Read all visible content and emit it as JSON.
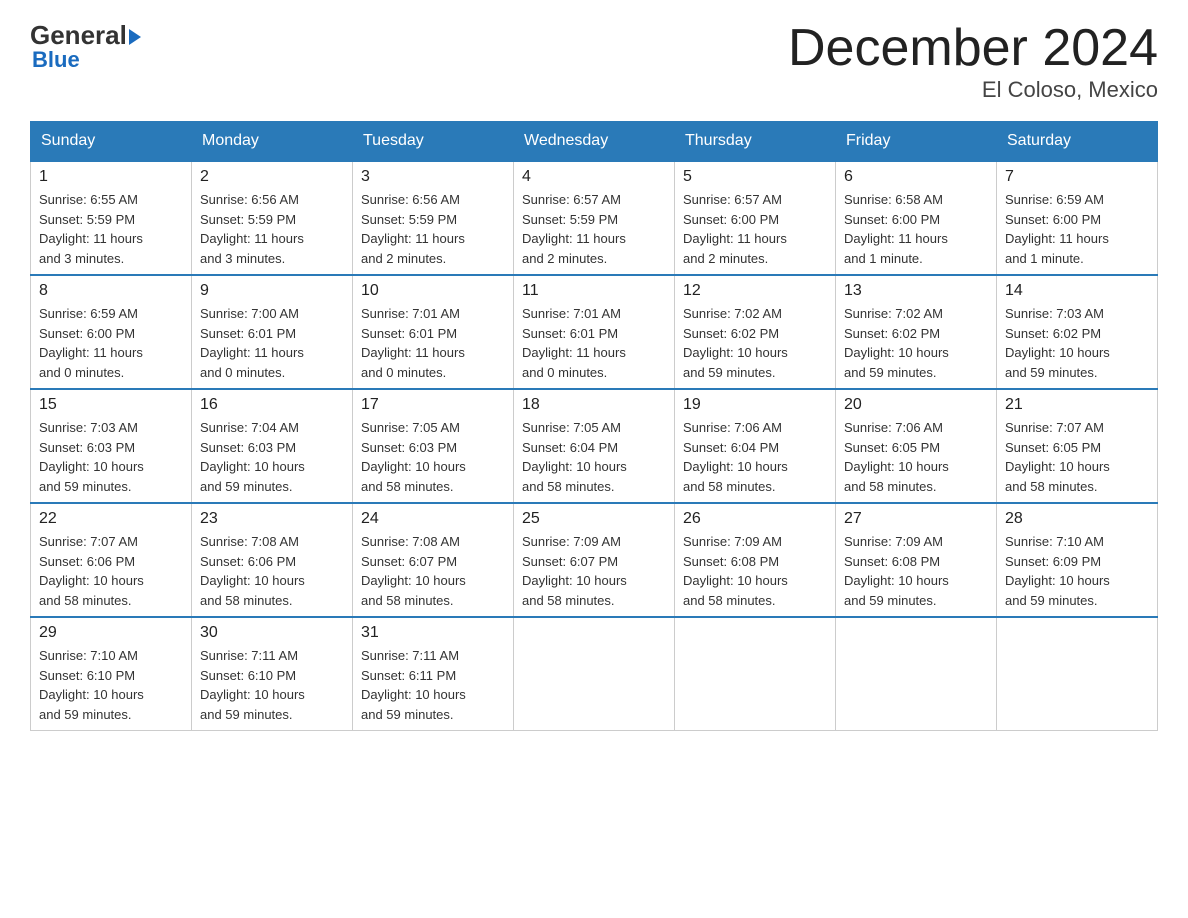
{
  "header": {
    "logo_top": "General",
    "logo_bottom": "Blue",
    "title": "December 2024",
    "subtitle": "El Coloso, Mexico"
  },
  "weekdays": [
    "Sunday",
    "Monday",
    "Tuesday",
    "Wednesday",
    "Thursday",
    "Friday",
    "Saturday"
  ],
  "weeks": [
    [
      {
        "day": "1",
        "sunrise": "6:55 AM",
        "sunset": "5:59 PM",
        "daylight": "11 hours and 3 minutes."
      },
      {
        "day": "2",
        "sunrise": "6:56 AM",
        "sunset": "5:59 PM",
        "daylight": "11 hours and 3 minutes."
      },
      {
        "day": "3",
        "sunrise": "6:56 AM",
        "sunset": "5:59 PM",
        "daylight": "11 hours and 2 minutes."
      },
      {
        "day": "4",
        "sunrise": "6:57 AM",
        "sunset": "5:59 PM",
        "daylight": "11 hours and 2 minutes."
      },
      {
        "day": "5",
        "sunrise": "6:57 AM",
        "sunset": "6:00 PM",
        "daylight": "11 hours and 2 minutes."
      },
      {
        "day": "6",
        "sunrise": "6:58 AM",
        "sunset": "6:00 PM",
        "daylight": "11 hours and 1 minute."
      },
      {
        "day": "7",
        "sunrise": "6:59 AM",
        "sunset": "6:00 PM",
        "daylight": "11 hours and 1 minute."
      }
    ],
    [
      {
        "day": "8",
        "sunrise": "6:59 AM",
        "sunset": "6:00 PM",
        "daylight": "11 hours and 0 minutes."
      },
      {
        "day": "9",
        "sunrise": "7:00 AM",
        "sunset": "6:01 PM",
        "daylight": "11 hours and 0 minutes."
      },
      {
        "day": "10",
        "sunrise": "7:01 AM",
        "sunset": "6:01 PM",
        "daylight": "11 hours and 0 minutes."
      },
      {
        "day": "11",
        "sunrise": "7:01 AM",
        "sunset": "6:01 PM",
        "daylight": "11 hours and 0 minutes."
      },
      {
        "day": "12",
        "sunrise": "7:02 AM",
        "sunset": "6:02 PM",
        "daylight": "10 hours and 59 minutes."
      },
      {
        "day": "13",
        "sunrise": "7:02 AM",
        "sunset": "6:02 PM",
        "daylight": "10 hours and 59 minutes."
      },
      {
        "day": "14",
        "sunrise": "7:03 AM",
        "sunset": "6:02 PM",
        "daylight": "10 hours and 59 minutes."
      }
    ],
    [
      {
        "day": "15",
        "sunrise": "7:03 AM",
        "sunset": "6:03 PM",
        "daylight": "10 hours and 59 minutes."
      },
      {
        "day": "16",
        "sunrise": "7:04 AM",
        "sunset": "6:03 PM",
        "daylight": "10 hours and 59 minutes."
      },
      {
        "day": "17",
        "sunrise": "7:05 AM",
        "sunset": "6:03 PM",
        "daylight": "10 hours and 58 minutes."
      },
      {
        "day": "18",
        "sunrise": "7:05 AM",
        "sunset": "6:04 PM",
        "daylight": "10 hours and 58 minutes."
      },
      {
        "day": "19",
        "sunrise": "7:06 AM",
        "sunset": "6:04 PM",
        "daylight": "10 hours and 58 minutes."
      },
      {
        "day": "20",
        "sunrise": "7:06 AM",
        "sunset": "6:05 PM",
        "daylight": "10 hours and 58 minutes."
      },
      {
        "day": "21",
        "sunrise": "7:07 AM",
        "sunset": "6:05 PM",
        "daylight": "10 hours and 58 minutes."
      }
    ],
    [
      {
        "day": "22",
        "sunrise": "7:07 AM",
        "sunset": "6:06 PM",
        "daylight": "10 hours and 58 minutes."
      },
      {
        "day": "23",
        "sunrise": "7:08 AM",
        "sunset": "6:06 PM",
        "daylight": "10 hours and 58 minutes."
      },
      {
        "day": "24",
        "sunrise": "7:08 AM",
        "sunset": "6:07 PM",
        "daylight": "10 hours and 58 minutes."
      },
      {
        "day": "25",
        "sunrise": "7:09 AM",
        "sunset": "6:07 PM",
        "daylight": "10 hours and 58 minutes."
      },
      {
        "day": "26",
        "sunrise": "7:09 AM",
        "sunset": "6:08 PM",
        "daylight": "10 hours and 58 minutes."
      },
      {
        "day": "27",
        "sunrise": "7:09 AM",
        "sunset": "6:08 PM",
        "daylight": "10 hours and 59 minutes."
      },
      {
        "day": "28",
        "sunrise": "7:10 AM",
        "sunset": "6:09 PM",
        "daylight": "10 hours and 59 minutes."
      }
    ],
    [
      {
        "day": "29",
        "sunrise": "7:10 AM",
        "sunset": "6:10 PM",
        "daylight": "10 hours and 59 minutes."
      },
      {
        "day": "30",
        "sunrise": "7:11 AM",
        "sunset": "6:10 PM",
        "daylight": "10 hours and 59 minutes."
      },
      {
        "day": "31",
        "sunrise": "7:11 AM",
        "sunset": "6:11 PM",
        "daylight": "10 hours and 59 minutes."
      },
      null,
      null,
      null,
      null
    ]
  ],
  "labels": {
    "sunrise": "Sunrise:",
    "sunset": "Sunset:",
    "daylight": "Daylight:"
  }
}
